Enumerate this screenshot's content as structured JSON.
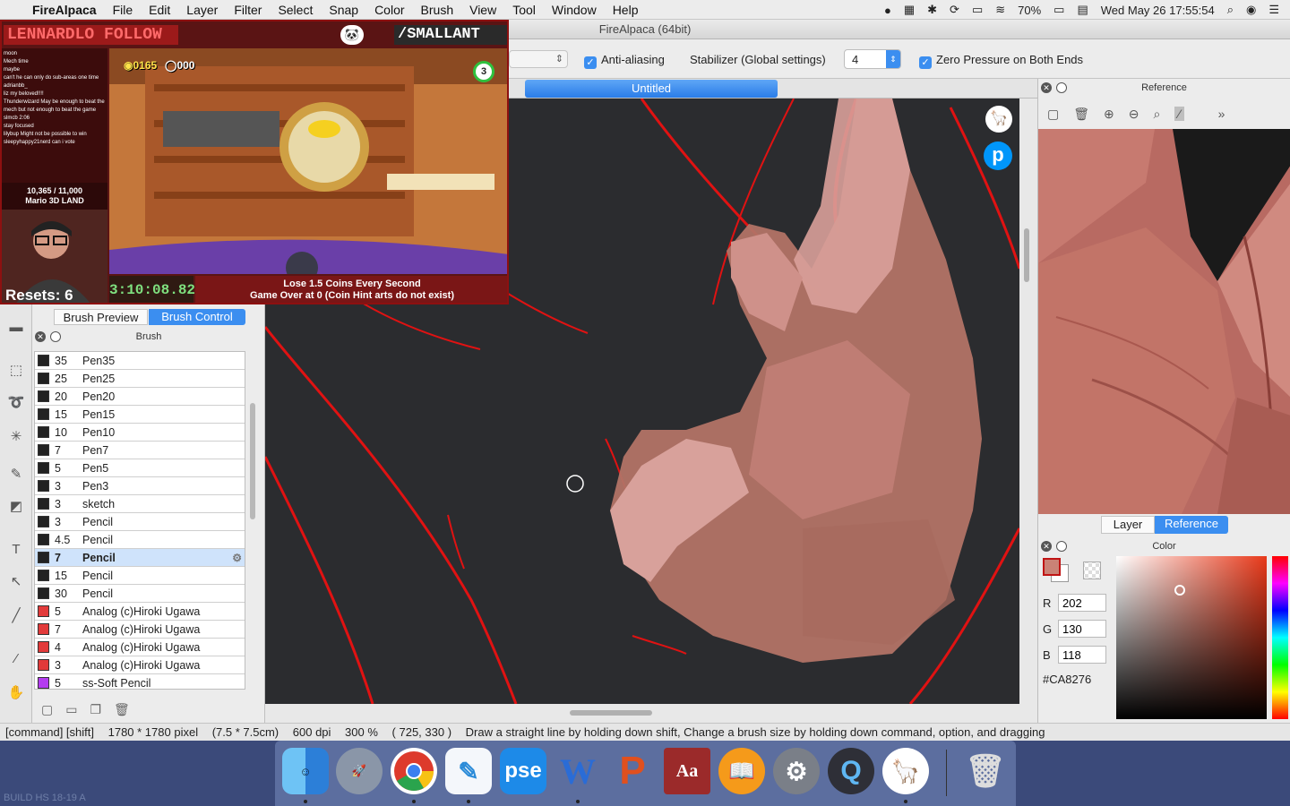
{
  "menubar": {
    "apple": "",
    "app_name": "FireAlpaca",
    "items": [
      "File",
      "Edit",
      "Layer",
      "Filter",
      "Select",
      "Snap",
      "Color",
      "Brush",
      "View",
      "Tool",
      "Window",
      "Help"
    ],
    "battery": "70%",
    "clock": "Wed May 26  17:55:54"
  },
  "window": {
    "title": "FireAlpaca (64bit)"
  },
  "toolbar": {
    "antialias_label": "Anti-aliasing",
    "stabilizer_label": "Stabilizer (Global settings)",
    "stabilizer_value": "4",
    "zero_pressure_label": "Zero Pressure on Both Ends"
  },
  "document": {
    "tab_title": "Untitled"
  },
  "brush_panel": {
    "tab_preview": "Brush Preview",
    "tab_control": "Brush Control",
    "title": "Brush",
    "brushes": [
      {
        "size": "35",
        "name": "Pen35",
        "color": "#222222"
      },
      {
        "size": "25",
        "name": "Pen25",
        "color": "#222222"
      },
      {
        "size": "20",
        "name": "Pen20",
        "color": "#222222"
      },
      {
        "size": "15",
        "name": "Pen15",
        "color": "#222222"
      },
      {
        "size": "10",
        "name": "Pen10",
        "color": "#222222"
      },
      {
        "size": "7",
        "name": "Pen7",
        "color": "#222222"
      },
      {
        "size": "5",
        "name": "Pen5",
        "color": "#222222"
      },
      {
        "size": "3",
        "name": "Pen3",
        "color": "#222222"
      },
      {
        "size": "3",
        "name": "sketch",
        "color": "#222222"
      },
      {
        "size": "3",
        "name": "Pencil",
        "color": "#222222"
      },
      {
        "size": "4.5",
        "name": "Pencil",
        "color": "#222222"
      },
      {
        "size": "7",
        "name": "Pencil",
        "color": "#222222",
        "selected": true
      },
      {
        "size": "15",
        "name": "Pencil",
        "color": "#222222"
      },
      {
        "size": "30",
        "name": "Pencil",
        "color": "#222222"
      },
      {
        "size": "5",
        "name": "Analog (c)Hiroki Ugawa",
        "color": "#e23a3a"
      },
      {
        "size": "7",
        "name": "Analog (c)Hiroki Ugawa",
        "color": "#e23a3a"
      },
      {
        "size": "4",
        "name": "Analog (c)Hiroki Ugawa",
        "color": "#e23a3a"
      },
      {
        "size": "3",
        "name": "Analog (c)Hiroki Ugawa",
        "color": "#e23a3a"
      },
      {
        "size": "5",
        "name": "ss-Soft Pencil",
        "color": "#b43cf0"
      }
    ]
  },
  "reference_panel": {
    "title": "Reference",
    "tab_layer": "Layer",
    "tab_reference": "Reference"
  },
  "color_panel": {
    "title": "Color",
    "r_label": "R",
    "g_label": "G",
    "b_label": "B",
    "r": "202",
    "g": "130",
    "b": "118",
    "hex": "#CA8276"
  },
  "statusbar": {
    "modifiers": "[command] [shift]",
    "size": "1780 * 1780 pixel",
    "physical": "(7.5 * 7.5cm)",
    "dpi": "600 dpi",
    "zoom": "300 %",
    "coords": "( 725, 330 )",
    "hint": "Draw a straight line by holding down shift, Change a brush size by holding down command, option, and dragging"
  },
  "stream_overlay": {
    "follow": "LENNARDLO FOLLOW",
    "handle": "/SMALLANT",
    "chat_lines": [
      "moon",
      "Mech time",
      "maybe",
      "can't he can only do sub-areas one time",
      "adrianbb_",
      "liz my beloved!!!!",
      "Thunderwizard  May be enough to beat the mech but not enough to beat the game",
      "slmcb  2:06",
      "stay focused",
      "lilybup  Might not be possible to win",
      "sleepyhappy21nerd  can i vote"
    ],
    "goal": "10,365 / 11,000",
    "game": "Mario 3D LAND",
    "coins": "0165",
    "lives": "000",
    "resets": "Resets: 6",
    "timer": "3:10:08.82",
    "rule_line1": "Lose 1.5 Coins Every Second",
    "rule_line2": "Game Over at 0 (Coin Hint arts do not exist)"
  },
  "dock": {
    "apps": [
      "Finder",
      "Launchpad",
      "Chrome",
      "Pages",
      "PSE",
      "Word",
      "PowerPoint",
      "Dictionary",
      "iBooks",
      "System Preferences",
      "QuickTime",
      "FireAlpaca",
      "Trash"
    ],
    "pse_label": "pse",
    "word_label": "W",
    "ppt_label": "P",
    "dict_label": "Aa"
  },
  "desktop": {
    "build_text": "BUILD HS 18-19 A"
  }
}
